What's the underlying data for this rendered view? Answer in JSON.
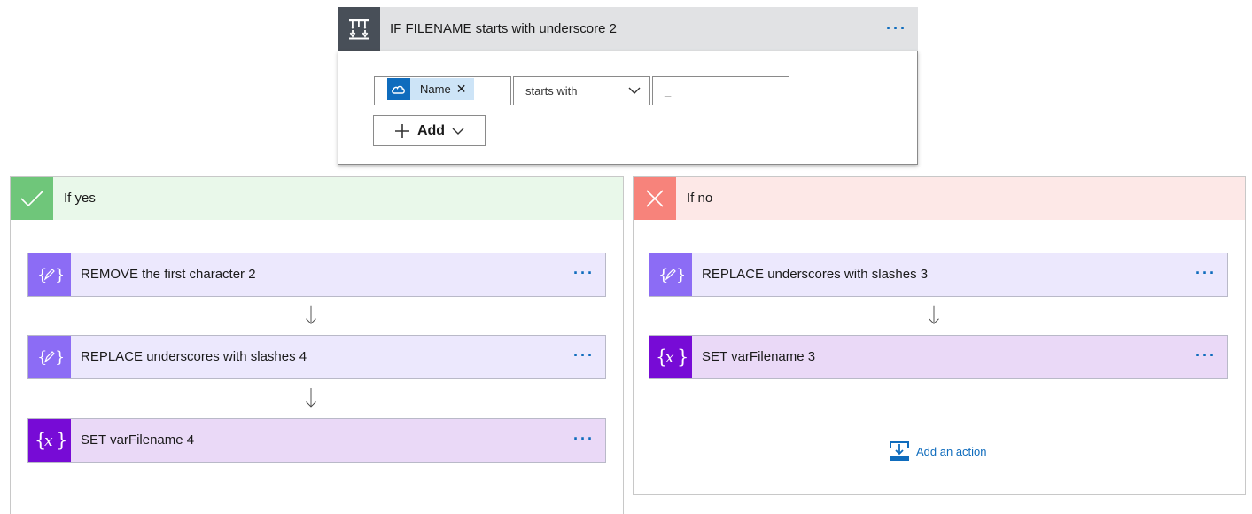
{
  "condition": {
    "title": "IF FILENAME starts with underscore 2",
    "more": "···",
    "token_label": "Name",
    "token_remove": "✕",
    "operator": "starts with",
    "value": "_",
    "add_label": "Add"
  },
  "yes_branch": {
    "title": "If yes",
    "actions": [
      {
        "title": "REMOVE the first character 2",
        "more": "···"
      },
      {
        "title": "REPLACE underscores with slashes 4",
        "more": "···"
      },
      {
        "title": "SET varFilename 4",
        "more": "···"
      }
    ]
  },
  "no_branch": {
    "title": "If no",
    "actions": [
      {
        "title": "REPLACE underscores with slashes 3",
        "more": "···"
      },
      {
        "title": "SET varFilename 3",
        "more": "···"
      }
    ],
    "add_action_label": "Add an action"
  },
  "colors": {
    "condition_icon_bg": "#484f58",
    "yes_accent": "#6fc67a",
    "no_accent": "#f7837b",
    "compose_icon_bg": "#8c6cf5",
    "variable_icon_bg": "#770bd6",
    "link": "#0f6cbd"
  },
  "icons": [
    "condition-icon",
    "onedrive-cloud-icon",
    "close-icon",
    "chevron-down-icon",
    "plus-icon",
    "check-icon",
    "x-icon",
    "compose-icon",
    "variable-icon",
    "arrow-down-icon",
    "add-action-icon",
    "more-icon"
  ]
}
